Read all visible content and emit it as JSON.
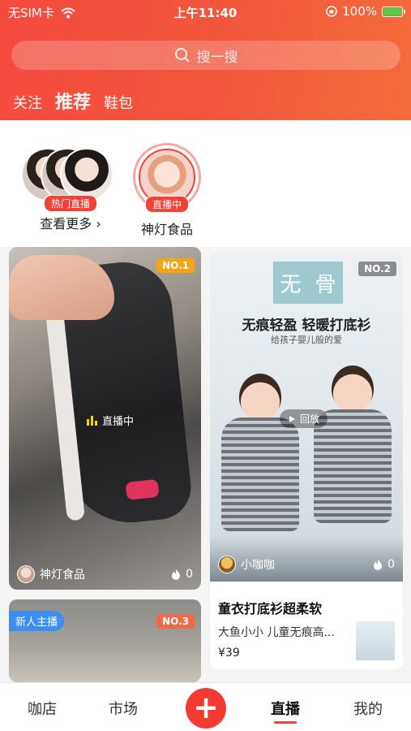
{
  "status_bar": {
    "carrier": "无SIM卡",
    "time": "上午11:40",
    "battery": "100%",
    "icons": [
      "wifi-icon",
      "orientation-lock-icon",
      "battery-icon"
    ]
  },
  "search": {
    "placeholder": "搜一搜",
    "icon": "search-icon"
  },
  "top_tabs": [
    {
      "label": "关注",
      "active": false
    },
    {
      "label": "推荐",
      "active": true
    },
    {
      "label": "鞋包",
      "active": false
    }
  ],
  "stories": [
    {
      "badge": "热门直播",
      "label": "查看更多 ›"
    },
    {
      "badge": "直播中",
      "label": "神灯食品"
    }
  ],
  "cards": {
    "card1": {
      "rank": "NO.1",
      "live_text": "直播中",
      "author": "神灯食品",
      "likes": "0"
    },
    "card2": {
      "rank": "NO.2",
      "logo_chars": [
        "无",
        "骨"
      ],
      "headline": "无痕轻盈 轻暖打底衫",
      "subline": "给孩子婴儿般的爱",
      "replay_text": "回放",
      "author": "小咖咖",
      "likes": "0",
      "title": "童衣打底衫超柔软",
      "desc": "大鱼小小 儿童无痕高...",
      "price": "¥39"
    },
    "card3": {
      "tag": "新人主播",
      "rank": "NO.3"
    }
  },
  "bottom_nav": [
    {
      "label": "咖店",
      "active": false
    },
    {
      "label": "市场",
      "active": false
    },
    {
      "label": "+",
      "active": false
    },
    {
      "label": "直播",
      "active": true
    },
    {
      "label": "我的",
      "active": false
    }
  ],
  "colors": {
    "accent": "#f44036",
    "header_start": "#f44a3e",
    "header_end": "#f46b3b",
    "new_tag": "#3a8ff0"
  }
}
